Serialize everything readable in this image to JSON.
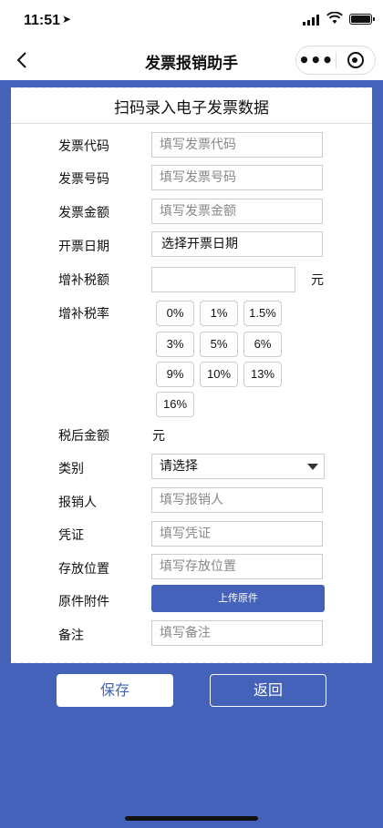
{
  "status_bar": {
    "time": "11:51"
  },
  "navbar": {
    "title": "发票报销助手",
    "more_glyph": "•••"
  },
  "card": {
    "title": "扫码录入电子发票数据",
    "fields": {
      "invoice_code": {
        "label": "发票代码",
        "placeholder": "填写发票代码"
      },
      "invoice_number": {
        "label": "发票号码",
        "placeholder": "填写发票号码"
      },
      "invoice_amount": {
        "label": "发票金额",
        "placeholder": "填写发票金额"
      },
      "issue_date": {
        "label": "开票日期",
        "value": "选择开票日期"
      },
      "extra_tax": {
        "label": "增补税额",
        "value": "",
        "unit": "元"
      },
      "extra_tax_rate": {
        "label": "增补税率",
        "options": [
          "0%",
          "1%",
          "1.5%",
          "3%",
          "5%",
          "6%",
          "9%",
          "10%",
          "13%",
          "16%"
        ]
      },
      "after_tax": {
        "label": "税后金额",
        "unit": "元"
      },
      "category": {
        "label": "类别",
        "value": "请选择"
      },
      "reimburser": {
        "label": "报销人",
        "placeholder": "填写报销人"
      },
      "voucher": {
        "label": "凭证",
        "placeholder": "填写凭证"
      },
      "location": {
        "label": "存放位置",
        "placeholder": "填写存放位置"
      },
      "attachment": {
        "label": "原件附件",
        "button": "上传原件"
      },
      "remark": {
        "label": "备注",
        "placeholder": "填写备注"
      }
    }
  },
  "actions": {
    "save": "保存",
    "back": "返回"
  },
  "colors": {
    "primary": "#4462ba",
    "background": "#4462ba",
    "card": "#ffffff"
  },
  "icons": [
    "back-chevron-icon",
    "more-icon",
    "close-target-icon",
    "signal-icon",
    "wifi-icon",
    "battery-icon",
    "location-arrow-icon",
    "dropdown-caret-icon"
  ]
}
